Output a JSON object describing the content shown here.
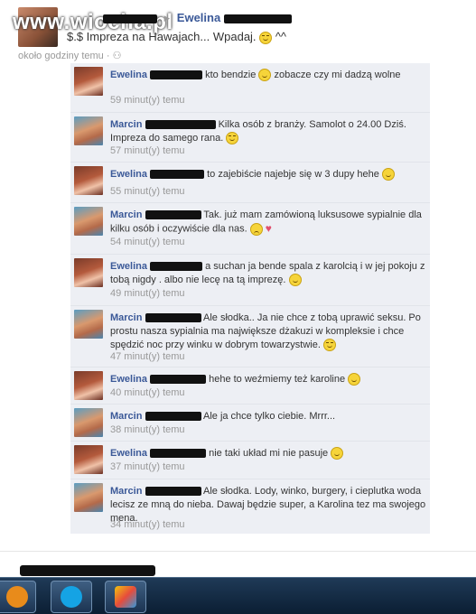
{
  "watermark": "www.wiocha.pl",
  "post": {
    "author": "Ewelina",
    "text": "$.$ Impreza na Hawajach... Wpadaj.",
    "tail": "^^",
    "time": "około godziny temu"
  },
  "comments": [
    {
      "author": "Ewelina",
      "avatar": "ewelina",
      "text": "kto bendzie",
      "text2": "zobacze czy mi dadzą wolne",
      "emoji": "smile",
      "time": "59 minut(y) temu"
    },
    {
      "author": "Marcin",
      "avatar": "marcin",
      "text": "Kilka osób z branży. Samolot o 24.00 Dziś. Impreza do samego rana.",
      "emoji": "wink",
      "time": "57 minut(y) temu"
    },
    {
      "author": "Ewelina",
      "avatar": "ewelina",
      "text": "to zajebiście najebje się w 3 dupy hehe",
      "emoji": "smile",
      "time": "55 minut(y) temu"
    },
    {
      "author": "Marcin",
      "avatar": "marcin",
      "text": "Tak. już mam zamówioną luksusowe sypialnie dla kilku osób i oczywiście dla nas.",
      "emoji": "sad",
      "extra": "heart",
      "time": "54 minut(y) temu"
    },
    {
      "author": "Ewelina",
      "avatar": "ewelina",
      "text": "a suchan ja bende spala z karolcią i w jej pokoju z tobą nigdy . albo nie lecę na tą imprezę.",
      "emoji": "smile",
      "time": "49 minut(y) temu"
    },
    {
      "author": "Marcin",
      "avatar": "marcin",
      "text": "Ale słodka.. Ja nie chce z tobą uprawić seksu. Po prostu nasza sypialnia ma największe dżakuzi w kompleksie i chce spędzić noc przy winku w dobrym towarzystwie.",
      "emoji": "wink",
      "time": "47 minut(y) temu"
    },
    {
      "author": "Ewelina",
      "avatar": "ewelina",
      "text": "hehe to weźmiemy też karoline",
      "emoji": "smile",
      "time": "40 minut(y) temu"
    },
    {
      "author": "Marcin",
      "avatar": "marcin",
      "text": "Ale ja chce tylko ciebie. Mrrr...",
      "emoji": "",
      "time": "38 minut(y) temu"
    },
    {
      "author": "Ewelina",
      "avatar": "ewelina",
      "text": "nie taki układ mi nie pasuje",
      "emoji": "smile",
      "time": "37 minut(y) temu"
    },
    {
      "author": "Marcin",
      "avatar": "marcin",
      "text": "Ale słodka. Lody, winko, burgery, i cieplutka woda lecisz ze mną do nieba. Dawaj będzie super, a Karolina tez ma swojego mena.",
      "emoji": "",
      "time": "34 minut(y) temu"
    }
  ],
  "taskbar": [
    "media-player-icon",
    "skype-icon",
    "paint-icon"
  ]
}
